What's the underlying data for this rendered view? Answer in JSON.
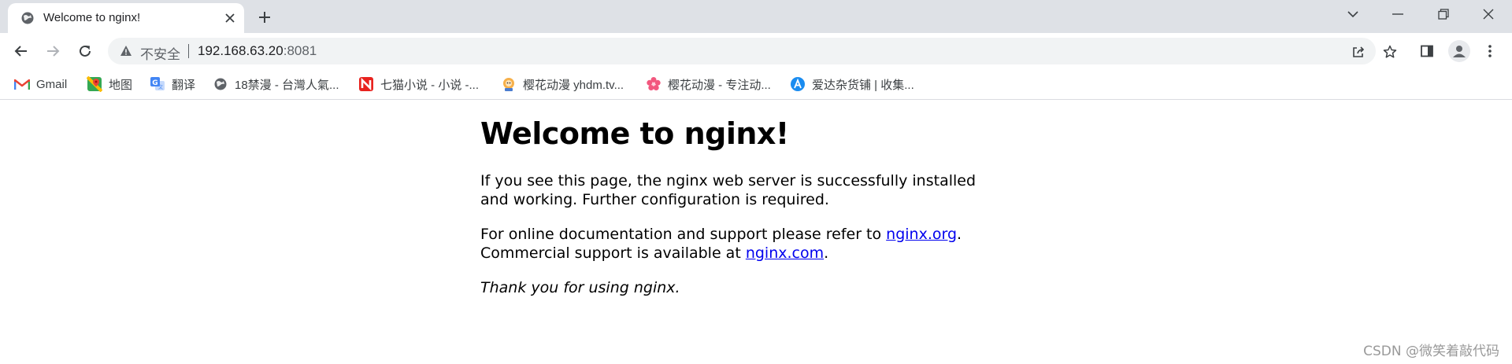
{
  "tab": {
    "title": "Welcome to nginx!"
  },
  "address_bar": {
    "security_label": "不安全",
    "host": "192.168.63.20",
    "port": ":8081"
  },
  "bookmarks": [
    {
      "label": "Gmail",
      "icon": "gmail-icon"
    },
    {
      "label": "地图",
      "icon": "maps-icon"
    },
    {
      "label": "翻译",
      "icon": "translate-icon"
    },
    {
      "label": "18禁漫 - 台灣人氣...",
      "icon": "globe-icon"
    },
    {
      "label": "七猫小说 - 小说 -...",
      "icon": "qimao-icon"
    },
    {
      "label": "樱花动漫 yhdm.tv...",
      "icon": "yhdm-icon"
    },
    {
      "label": "樱花动漫 - 专注动...",
      "icon": "sakura-icon"
    },
    {
      "label": "爱达杂货铺 | 收集...",
      "icon": "aida-icon"
    }
  ],
  "page": {
    "heading": "Welcome to nginx!",
    "para1": "If you see this page, the nginx web server is successfully installed and working. Further configuration is required.",
    "para2_prefix": "For online documentation and support please refer to ",
    "link1": "nginx.org",
    "para2_mid": ".",
    "para2_line2": "Commercial support is available at ",
    "link2": "nginx.com",
    "para2_end": ".",
    "thanks": "Thank you for using nginx."
  },
  "watermark": "CSDN @微笑着敲代码",
  "colors": {
    "tabstrip": "#dee1e6",
    "omnibox": "#f1f3f4",
    "link": "#0000ee",
    "icon": "#5f6368"
  }
}
